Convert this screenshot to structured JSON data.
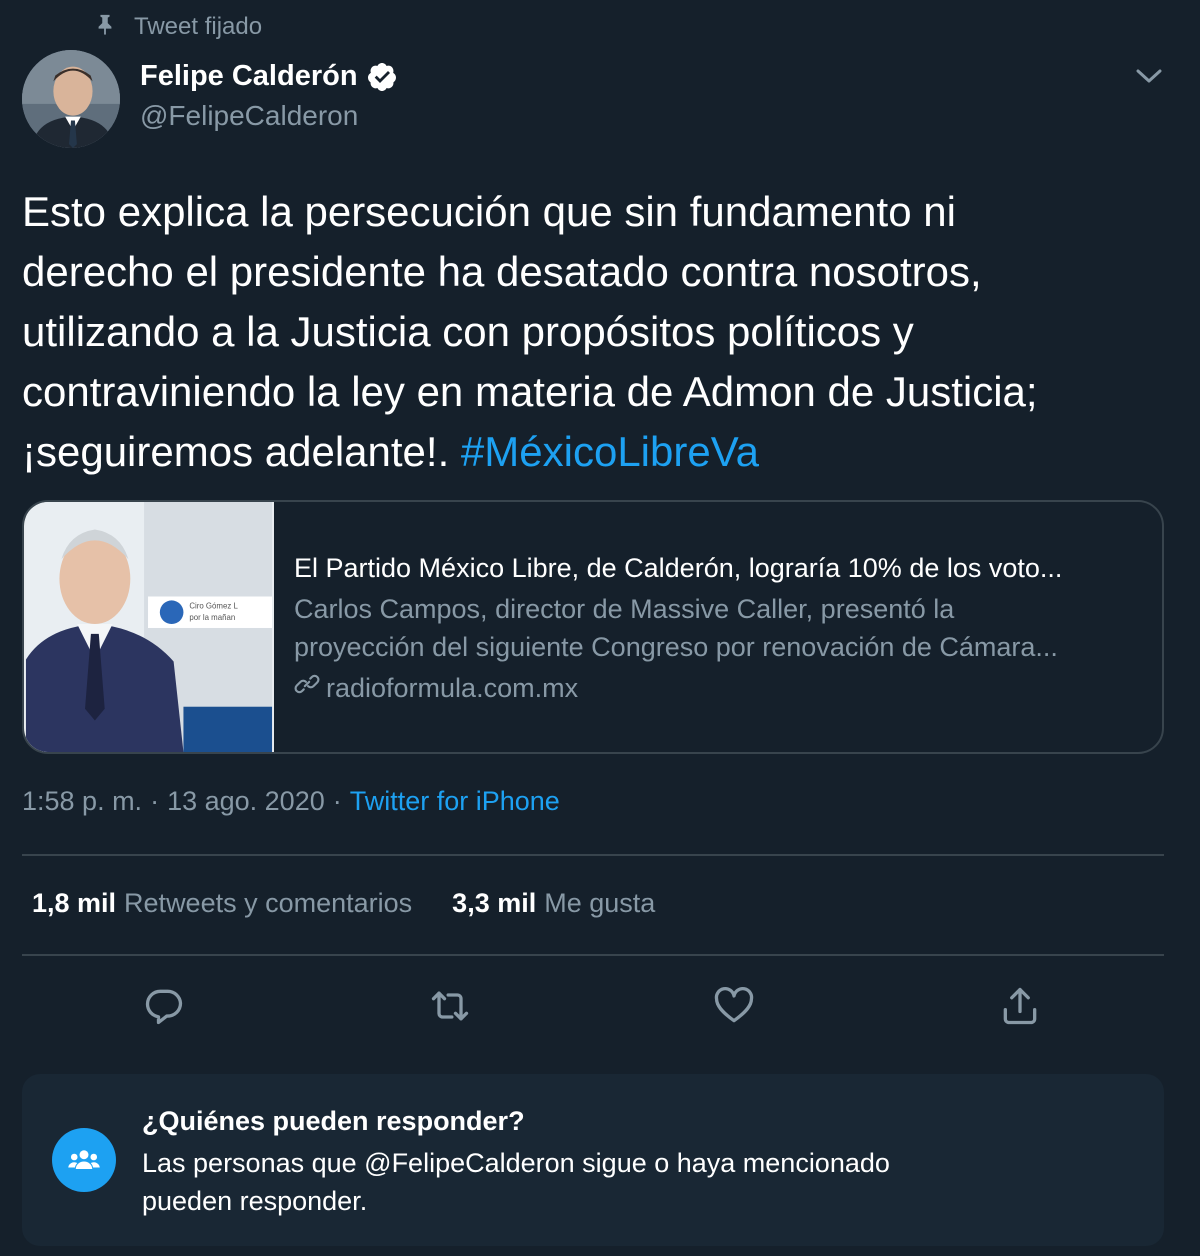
{
  "pinned": {
    "label": "Tweet fijado",
    "icon": "pin-icon"
  },
  "author": {
    "display_name": "Felipe Calderón",
    "handle": "@FelipeCalderon",
    "verified": true
  },
  "tweet": {
    "text_lines": [
      "Esto explica la persecución que sin fundamento ni",
      "derecho el presidente ha desatado contra nosotros,",
      "utilizando a la Justicia con propósitos políticos y",
      "contraviniendo la ley en materia de Admon de Justicia;",
      "¡seguiremos adelante!."
    ],
    "hashtag": "#MéxicoLibreVa"
  },
  "card": {
    "title": "El Partido México Libre, de Calderón, lograría 10% de los voto...",
    "description_lines": [
      "Carlos Campos, director de Massive Caller, presentó la",
      "proyección del siguiente Congreso por renovación de Cámara..."
    ],
    "domain": "radioformula.com.mx",
    "image_caption": "Ciro Gómez Leyva por la mañana"
  },
  "meta": {
    "time": "1:58 p. m.",
    "separator": "·",
    "date": "13 ago. 2020",
    "separator2": "·",
    "source": "Twitter for iPhone"
  },
  "stats": {
    "retweets_count": "1,8 mil",
    "retweets_label": "Retweets y comentarios",
    "likes_count": "3,3 mil",
    "likes_label": "Me gusta"
  },
  "reply_restriction": {
    "title": "¿Quiénes pueden responder?",
    "text_line1": "Las personas que @FelipeCalderon sigue o haya mencionado",
    "text_line2": "pueden responder."
  },
  "colors": {
    "background": "#15202b",
    "accent": "#1da1f2",
    "secondary_text": "#8899a6",
    "border": "#38444d"
  }
}
